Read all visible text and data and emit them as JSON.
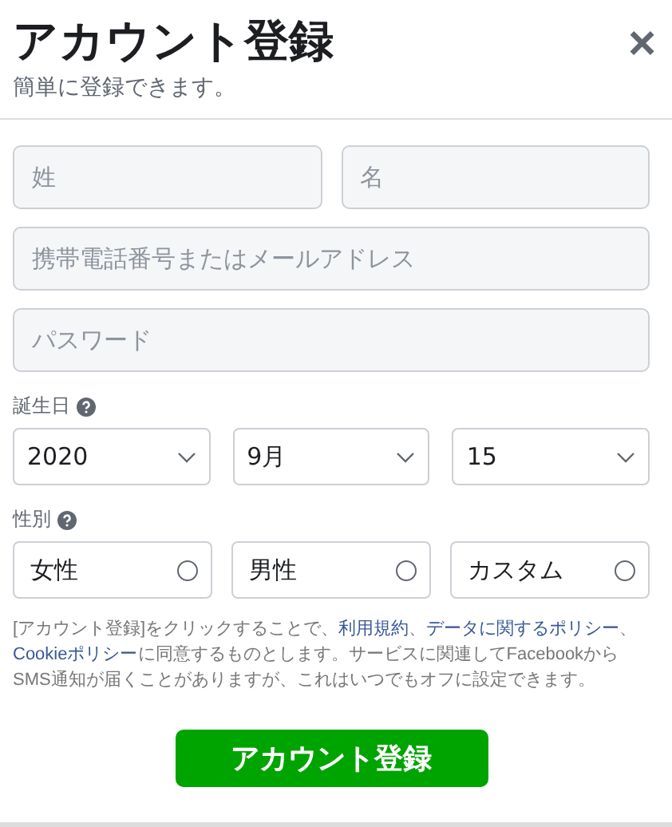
{
  "header": {
    "title": "アカウント登録",
    "subtitle": "簡単に登録できます。",
    "close": "×"
  },
  "name_fields": [
    {
      "placeholder": "姓"
    },
    {
      "placeholder": "名"
    }
  ],
  "contact_field": {
    "placeholder": "携帯電話番号またはメールアドレス"
  },
  "password_field": {
    "placeholder": "パスワード"
  },
  "birthday": {
    "label": "誕生日",
    "selects": [
      {
        "value": "2020"
      },
      {
        "value": "9月"
      },
      {
        "value": "15"
      }
    ]
  },
  "gender": {
    "label": "性別",
    "options": [
      {
        "label": "女性",
        "selected": false
      },
      {
        "label": "男性",
        "selected": false
      },
      {
        "label": "カスタム",
        "selected": false
      }
    ]
  },
  "terms": [
    {
      "text": "[アカウント登録]をクリックすることで、",
      "link": false
    },
    {
      "text": "利用規約",
      "link": true
    },
    {
      "text": "、",
      "link": false
    },
    {
      "text": "データに関するポリシー",
      "link": true
    },
    {
      "text": "、",
      "link": false
    },
    {
      "text": "Cookieポリシー",
      "link": true
    },
    {
      "text": "に同意するものとします。サービスに関連してFacebookからSMS通知が届くことがありますが、これはいつでもオフに設定できます。",
      "link": false
    }
  ],
  "submit": "アカウント登録"
}
